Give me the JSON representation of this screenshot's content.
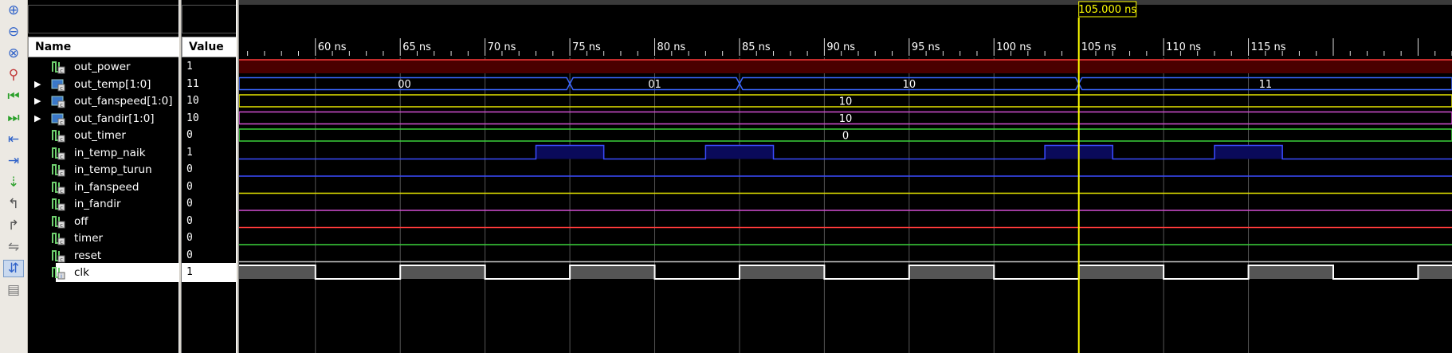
{
  "columns": {
    "name": "Name",
    "value": "Value"
  },
  "cursor": {
    "label": "105.000 ns",
    "time": 105
  },
  "time_axis": {
    "start": 55.5,
    "end": 127.0,
    "ticks": [
      60,
      65,
      70,
      75,
      80,
      85,
      90,
      95,
      100,
      105,
      110,
      115
    ],
    "unit": "ns"
  },
  "toolbar": {
    "icons": [
      "zoom-in-icon",
      "zoom-out-icon",
      "zoom-fit-icon",
      "zoom-full-icon",
      "go-to-start-icon",
      "go-to-end-icon",
      "previous-transition-icon",
      "next-transition-icon",
      "add-marker-icon",
      "previous-marker-icon",
      "next-marker-icon",
      "swap-cursors-icon",
      "snap-to-transition-icon",
      "float-ruler-icon"
    ],
    "active_index": 12
  },
  "signals": [
    {
      "name": "out_power",
      "value": "1",
      "bus": false,
      "color": "#ff3a3a",
      "kind": "bit",
      "segments": [
        [
          55.5,
          127,
          1
        ]
      ],
      "style": "high-fill"
    },
    {
      "name": "out_temp[1:0]",
      "value": "11",
      "bus": true,
      "color": "#3a66ff",
      "kind": "bus",
      "segments": [
        [
          55.5,
          75,
          "00"
        ],
        [
          75,
          85,
          "01"
        ],
        [
          85,
          105,
          "10"
        ],
        [
          105,
          127,
          "11"
        ]
      ]
    },
    {
      "name": "out_fanspeed[1:0]",
      "value": "10",
      "bus": true,
      "color": "#e6e600",
      "kind": "bus",
      "segments": [
        [
          55.5,
          127,
          "10"
        ]
      ]
    },
    {
      "name": "out_fandir[1:0]",
      "value": "10",
      "bus": true,
      "color": "#d24fd2",
      "kind": "bus",
      "segments": [
        [
          55.5,
          127,
          "10"
        ]
      ]
    },
    {
      "name": "out_timer",
      "value": "0",
      "bus": false,
      "color": "#3ad23a",
      "kind": "bus",
      "segments": [
        [
          55.5,
          127,
          "0"
        ]
      ]
    },
    {
      "name": "in_temp_naik",
      "value": "1",
      "bus": false,
      "color": "#3a4cff",
      "kind": "bit",
      "segments": [
        [
          55.5,
          73,
          0
        ],
        [
          73,
          77,
          1
        ],
        [
          77,
          83,
          0
        ],
        [
          83,
          87,
          1
        ],
        [
          87,
          103,
          0
        ],
        [
          103,
          107,
          1
        ],
        [
          107,
          113,
          0
        ],
        [
          113,
          117,
          1
        ],
        [
          117,
          127,
          0
        ]
      ]
    },
    {
      "name": "in_temp_turun",
      "value": "0",
      "bus": false,
      "color": "#3a4cff",
      "kind": "bit",
      "segments": [
        [
          55.5,
          127,
          0
        ]
      ]
    },
    {
      "name": "in_fanspeed",
      "value": "0",
      "bus": false,
      "color": "#e6e600",
      "kind": "bit",
      "segments": [
        [
          55.5,
          127,
          0
        ]
      ]
    },
    {
      "name": "in_fandir",
      "value": "0",
      "bus": false,
      "color": "#d24fd2",
      "kind": "bit",
      "segments": [
        [
          55.5,
          127,
          0
        ]
      ]
    },
    {
      "name": "off",
      "value": "0",
      "bus": false,
      "color": "#ff3a3a",
      "kind": "bit",
      "segments": [
        [
          55.5,
          127,
          0
        ]
      ]
    },
    {
      "name": "timer",
      "value": "0",
      "bus": false,
      "color": "#3ad23a",
      "kind": "bit",
      "segments": [
        [
          55.5,
          127,
          0
        ]
      ]
    },
    {
      "name": "reset",
      "value": "0",
      "bus": false,
      "color": "#c8c8c8",
      "kind": "bit",
      "segments": [
        [
          55.5,
          127,
          0
        ]
      ]
    },
    {
      "name": "clk",
      "value": "1",
      "bus": false,
      "color": "#ffffff",
      "kind": "clock",
      "period": 10,
      "first_fall": 60,
      "selected": true
    }
  ]
}
